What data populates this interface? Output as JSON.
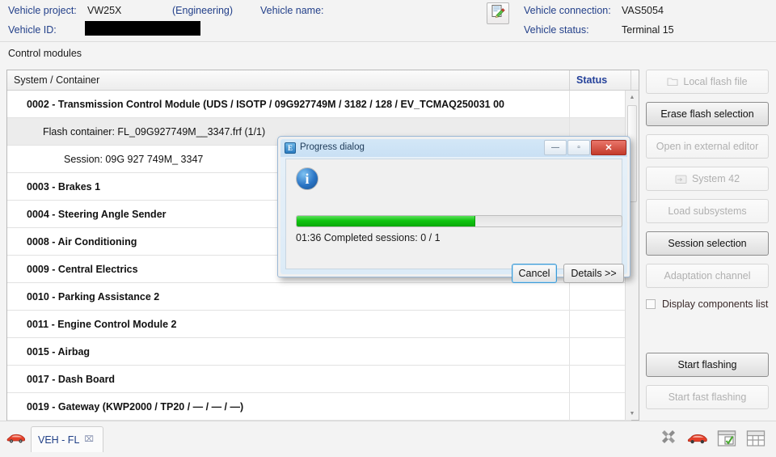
{
  "header": {
    "fields": [
      {
        "label": "Vehicle project:",
        "value": "VW25X"
      },
      {
        "label": "(Engineering)",
        "value": ""
      },
      {
        "label": "Vehicle name:",
        "value": ""
      },
      {
        "label": "Vehicle ID:",
        "value": ""
      },
      {
        "label": "Vehicle connection:",
        "value": "VAS5054"
      },
      {
        "label": "Vehicle status:",
        "value": "Terminal 15"
      }
    ],
    "icon": "notepad-pencil-icon"
  },
  "section": {
    "title": "Control modules"
  },
  "table": {
    "columns": [
      "System / Container",
      "Status"
    ],
    "rows": [
      {
        "indent": 1,
        "bold": true,
        "shaded": false,
        "text": "0002 - Transmission Control Module  (UDS / ISOTP / 09G927749M / 3182 / 128 / EV_TCMAQ250031 00",
        "status": ""
      },
      {
        "indent": 2,
        "bold": false,
        "shaded": true,
        "text": "Flash container: FL_09G927749M__3347.frf (1/1)",
        "status": ""
      },
      {
        "indent": 3,
        "bold": false,
        "shaded": false,
        "text": "Session: 09G 927 749M_ 3347",
        "status": ""
      },
      {
        "indent": 1,
        "bold": true,
        "shaded": false,
        "text": "0003 - Brakes 1",
        "status": ""
      },
      {
        "indent": 1,
        "bold": true,
        "shaded": false,
        "text": "0004 - Steering Angle Sender",
        "status": ""
      },
      {
        "indent": 1,
        "bold": true,
        "shaded": false,
        "text": "0008 - Air Conditioning",
        "status": ""
      },
      {
        "indent": 1,
        "bold": true,
        "shaded": false,
        "text": "0009 - Central Electrics",
        "status": ""
      },
      {
        "indent": 1,
        "bold": true,
        "shaded": false,
        "text": "0010 - Parking Assistance 2",
        "status": ""
      },
      {
        "indent": 1,
        "bold": true,
        "shaded": false,
        "text": "0011 - Engine Control Module 2",
        "status": ""
      },
      {
        "indent": 1,
        "bold": true,
        "shaded": false,
        "text": "0015 - Airbag",
        "status": ""
      },
      {
        "indent": 1,
        "bold": true,
        "shaded": false,
        "text": "0017 - Dash Board",
        "status": ""
      },
      {
        "indent": 1,
        "bold": true,
        "shaded": false,
        "text": "0019 - Gateway  (KWP2000 / TP20 / — / — / —)",
        "status": ""
      }
    ]
  },
  "buttons": [
    {
      "label": "Local flash file",
      "state": "disabled",
      "icon": "flash-file-icon"
    },
    {
      "label": "Erase flash selection",
      "state": "enabled",
      "icon": ""
    },
    {
      "label": "Open in external editor",
      "state": "disabled",
      "icon": ""
    },
    {
      "label": "System 42",
      "state": "disabled",
      "icon": "system-icon"
    },
    {
      "label": "Load subsystems",
      "state": "disabled",
      "icon": ""
    },
    {
      "label": "Session selection",
      "state": "enabled",
      "icon": ""
    },
    {
      "label": "Adaptation channel",
      "state": "disabled",
      "icon": ""
    }
  ],
  "checkbox": {
    "label": "Display components list",
    "checked": false
  },
  "action_buttons": [
    {
      "label": "Start flashing",
      "state": "enabled"
    },
    {
      "label": "Start fast flashing",
      "state": "disabled"
    }
  ],
  "dialog": {
    "title": "Progress dialog",
    "icon": "info-icon",
    "progress_percent": 55,
    "elapsed": "01:36",
    "status_text": "01:36  Completed sessions: 0 / 1",
    "buttons": [
      {
        "label": "Cancel",
        "primary": true
      },
      {
        "label": "Details >>",
        "primary": false
      }
    ],
    "window_controls": [
      "minimize",
      "maximize",
      "close"
    ],
    "accent_color": "#3c9ad6",
    "progress_color": "#10c410"
  },
  "bottom": {
    "tab": {
      "label": "VEH - FL",
      "close": "⌧",
      "icon": "car-icon"
    },
    "tray": [
      "tools-icon",
      "car-icon",
      "checklist-window-icon",
      "grid-table-icon"
    ]
  }
}
